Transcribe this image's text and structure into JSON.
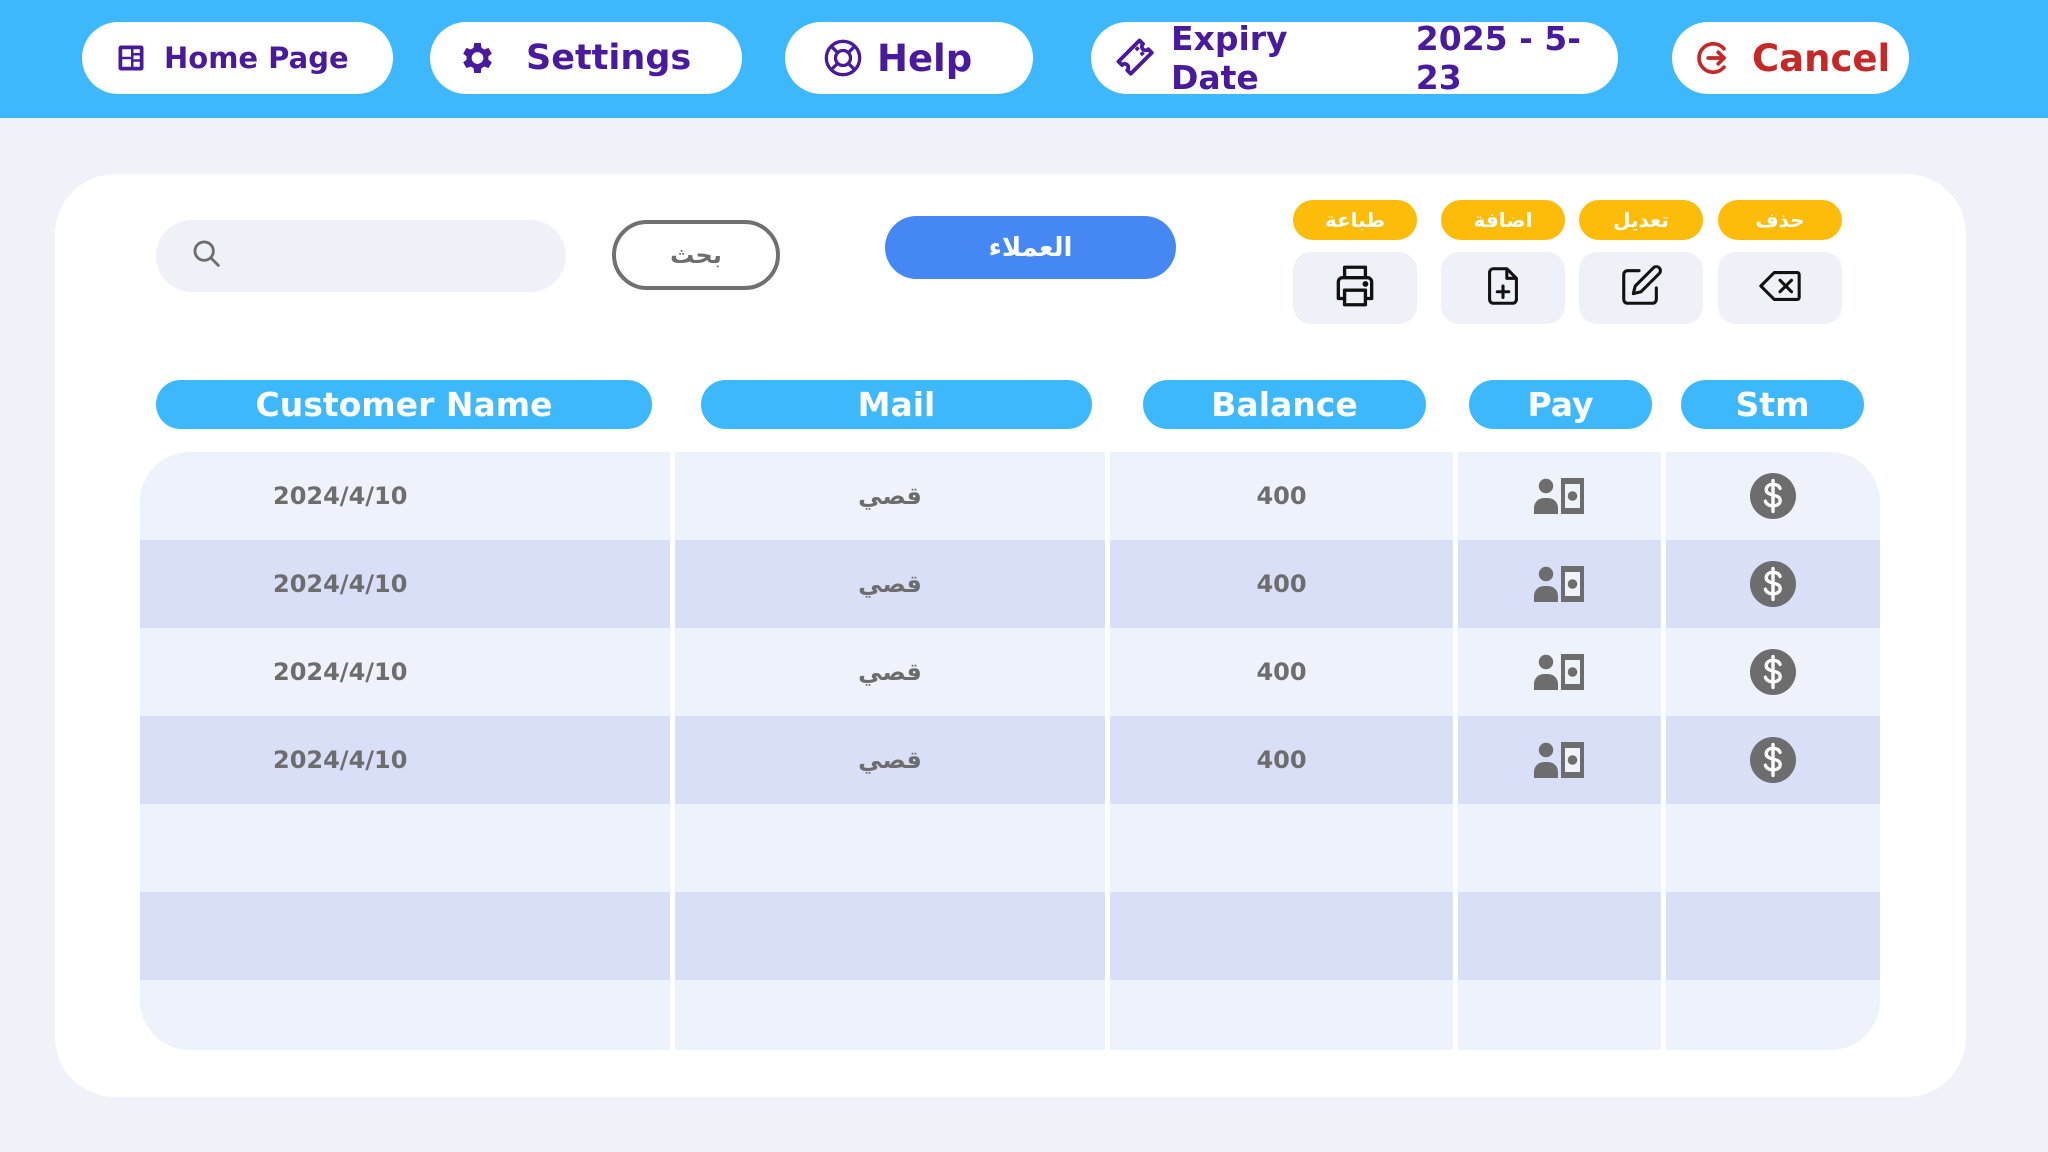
{
  "topbar": {
    "home_label": "Home Page",
    "settings_label": "Settings",
    "help_label": "Help",
    "expiry_label": "Expiry Date",
    "expiry_value": "2025 - 5-23",
    "cancel_label": "Cancel"
  },
  "toolbar": {
    "search_placeholder": "",
    "search_button_label": "بحث",
    "customers_button_label": "العملاء",
    "actions": [
      {
        "label": "طباعة",
        "icon": "printer-icon"
      },
      {
        "label": "اضافة",
        "icon": "file-add-icon"
      },
      {
        "label": "تعديل",
        "icon": "edit-icon"
      },
      {
        "label": "حذف",
        "icon": "backspace-delete-icon"
      }
    ]
  },
  "table": {
    "headers": [
      "Customer Name",
      "Mail",
      "Balance",
      "Pay",
      "Stm"
    ],
    "rows": [
      {
        "name": "2024/4/10",
        "mail": "قصي",
        "balance": "400",
        "pay_icon": "pay-cash-icon",
        "stm_icon": "dollar-circle-icon"
      },
      {
        "name": "2024/4/10",
        "mail": "قصي",
        "balance": "400",
        "pay_icon": "pay-cash-icon",
        "stm_icon": "dollar-circle-icon"
      },
      {
        "name": "2024/4/10",
        "mail": "قصي",
        "balance": "400",
        "pay_icon": "pay-cash-icon",
        "stm_icon": "dollar-circle-icon"
      },
      {
        "name": "2024/4/10",
        "mail": "قصي",
        "balance": "400",
        "pay_icon": "pay-cash-icon",
        "stm_icon": "dollar-circle-icon"
      },
      {
        "name": "",
        "mail": "",
        "balance": "",
        "pay_icon": "",
        "stm_icon": ""
      },
      {
        "name": "",
        "mail": "",
        "balance": "",
        "pay_icon": "",
        "stm_icon": ""
      },
      {
        "name": "",
        "mail": "",
        "balance": "",
        "pay_icon": "",
        "stm_icon": ""
      }
    ]
  },
  "colors": {
    "topbar": "#3EB8FC",
    "accent_purple": "#4A1A9C",
    "cancel_red": "#C62828",
    "action_yellow": "#FDBB0A",
    "customers_blue": "#4588F4",
    "row_light": "#EEF2FA",
    "row_dark": "#D9DFF6"
  }
}
